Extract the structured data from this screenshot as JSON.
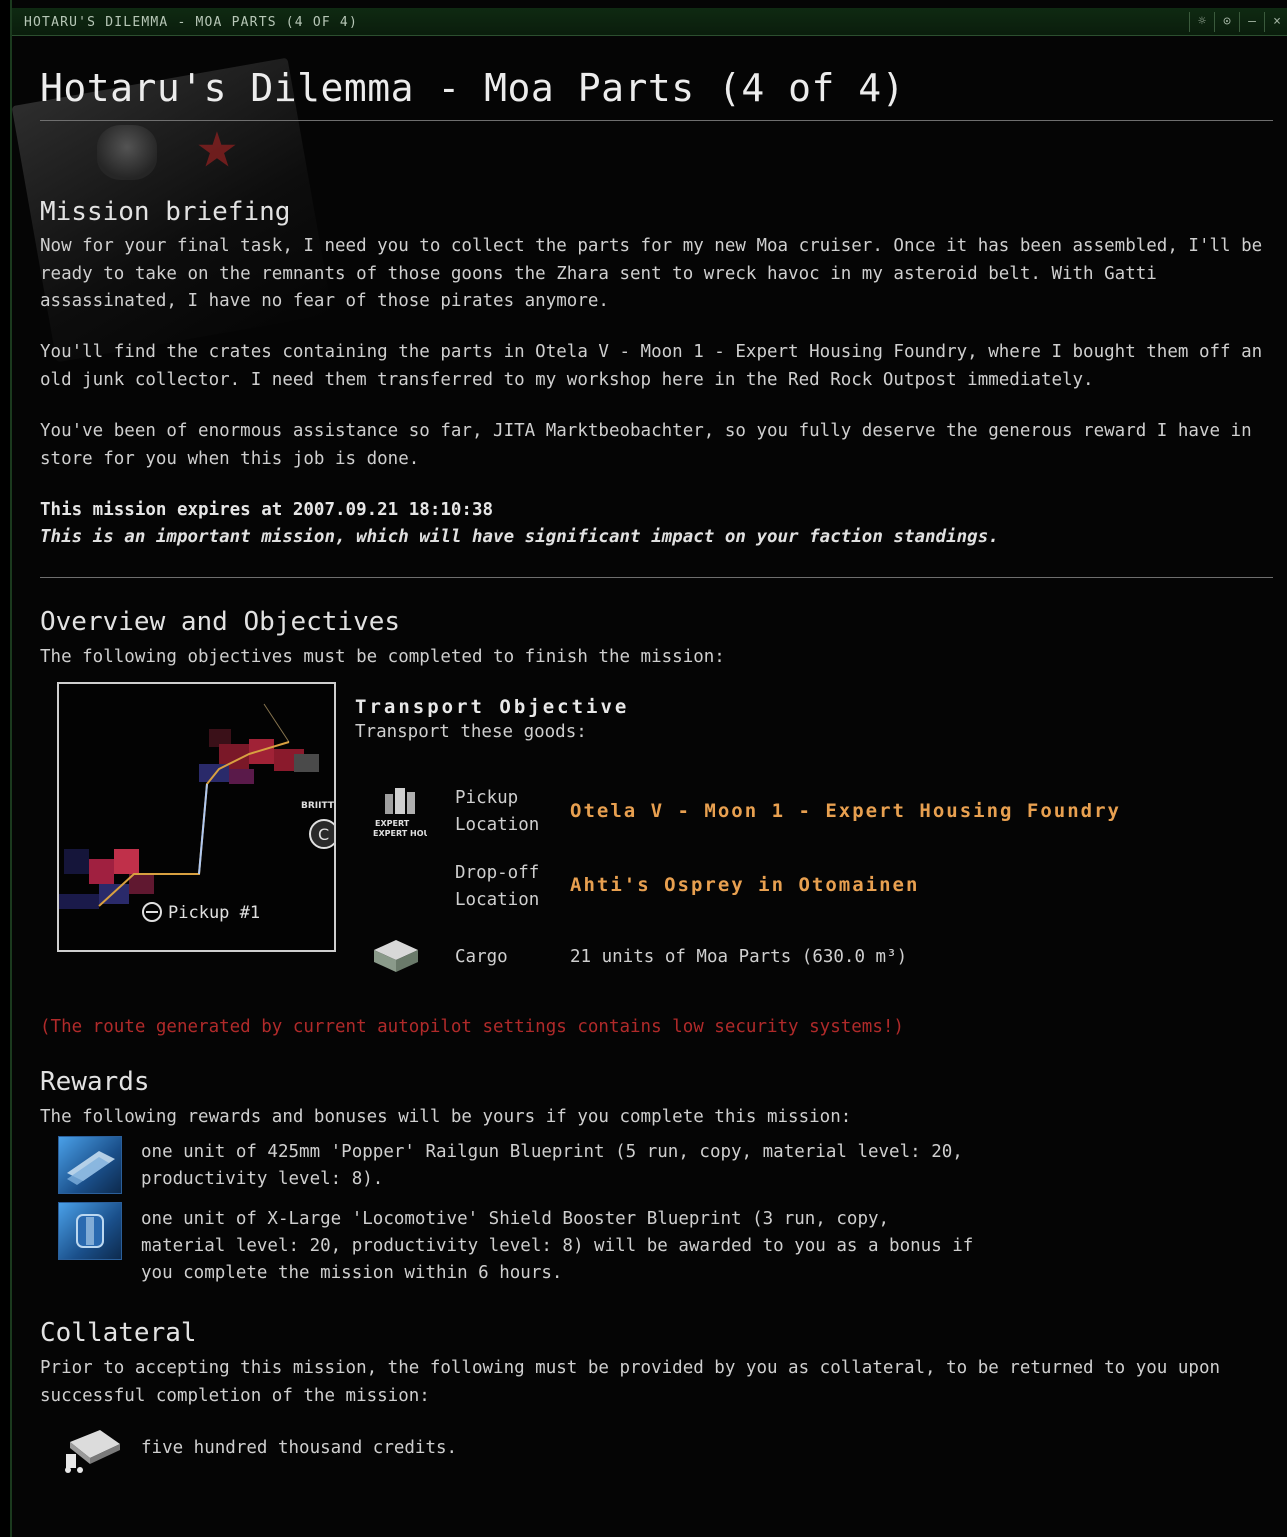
{
  "window": {
    "title": "HOTARU'S DILEMMA - MOA PARTS (4 OF 4)",
    "controls": [
      "☼",
      "⊙",
      "–",
      "×"
    ]
  },
  "heading": "Hotaru's Dilemma - Moa Parts (4 of 4)",
  "briefing": {
    "title": "Mission briefing",
    "paragraphs": [
      "Now for your final task, I need you to collect the parts for my new Moa cruiser. Once it has been assembled, I'll be ready to take on the remnants of those goons the Zhara sent to wreck havoc in my asteroid belt. With Gatti assassinated, I have no fear of those pirates anymore.",
      "You'll find the crates containing the parts in Otela V - Moon 1 - Expert Housing Foundry, where I bought them off an old junk collector. I need them transferred to my workshop here in the Red Rock Outpost immediately.",
      "You've been of enormous assistance so far, JITA Marktbeobachter, so you fully deserve the generous reward I have in store for you when this job is done."
    ],
    "expires": "This mission expires at 2007.09.21 18:10:38",
    "important": "This is an important mission, which will have significant impact on your faction standings."
  },
  "overview": {
    "title": "Overview and Objectives",
    "intro": "The following objectives must be completed to finish the mission:",
    "map": {
      "pickup_marker": "Pickup #1",
      "station_label": "EXPERT HOUSING",
      "small_label": "BRIITTO"
    },
    "objective": {
      "title": "Transport Objective",
      "subtitle": "Transport these goods:",
      "pickup_label_1": "Pickup",
      "pickup_label_2": "Location",
      "pickup_value": "Otela V - Moon 1 - Expert Housing Foundry",
      "dropoff_label_1": "Drop-off",
      "dropoff_label_2": "Location",
      "dropoff_value": "Ahti's Osprey in Otomainen",
      "cargo_label": "Cargo",
      "cargo_value": "21 units of Moa Parts (630.0 m³)"
    },
    "warning": "(The route generated by current autopilot settings contains low security systems!)"
  },
  "rewards": {
    "title": "Rewards",
    "intro": "The following rewards and bonuses will be yours if you complete this mission:",
    "items": [
      {
        "line1": "one unit of 425mm 'Popper' Railgun Blueprint (5 run, copy, material level: 20,",
        "line2": "productivity level: 8)."
      },
      {
        "line1": "one unit of X-Large 'Locomotive' Shield Booster Blueprint (3 run, copy,",
        "line2": "material level: 20, productivity level: 8) will be awarded to you as a bonus if",
        "line3": "you complete the mission within 6 hours."
      }
    ]
  },
  "collateral": {
    "title": "Collateral",
    "text": "Prior to accepting this mission, the following must be provided by you as collateral, to be returned to you upon successful completion of the mission:",
    "item": "five hundred thousand credits."
  },
  "colors": {
    "accent_orange": "#e8a050",
    "warning_red": "#b02a2a",
    "titlebar_green": "#0f2a12"
  },
  "icons": [
    "railgun-blueprint-icon",
    "shield-booster-blueprint-icon",
    "credits-icon",
    "station-icon",
    "cargo-container-icon"
  ]
}
